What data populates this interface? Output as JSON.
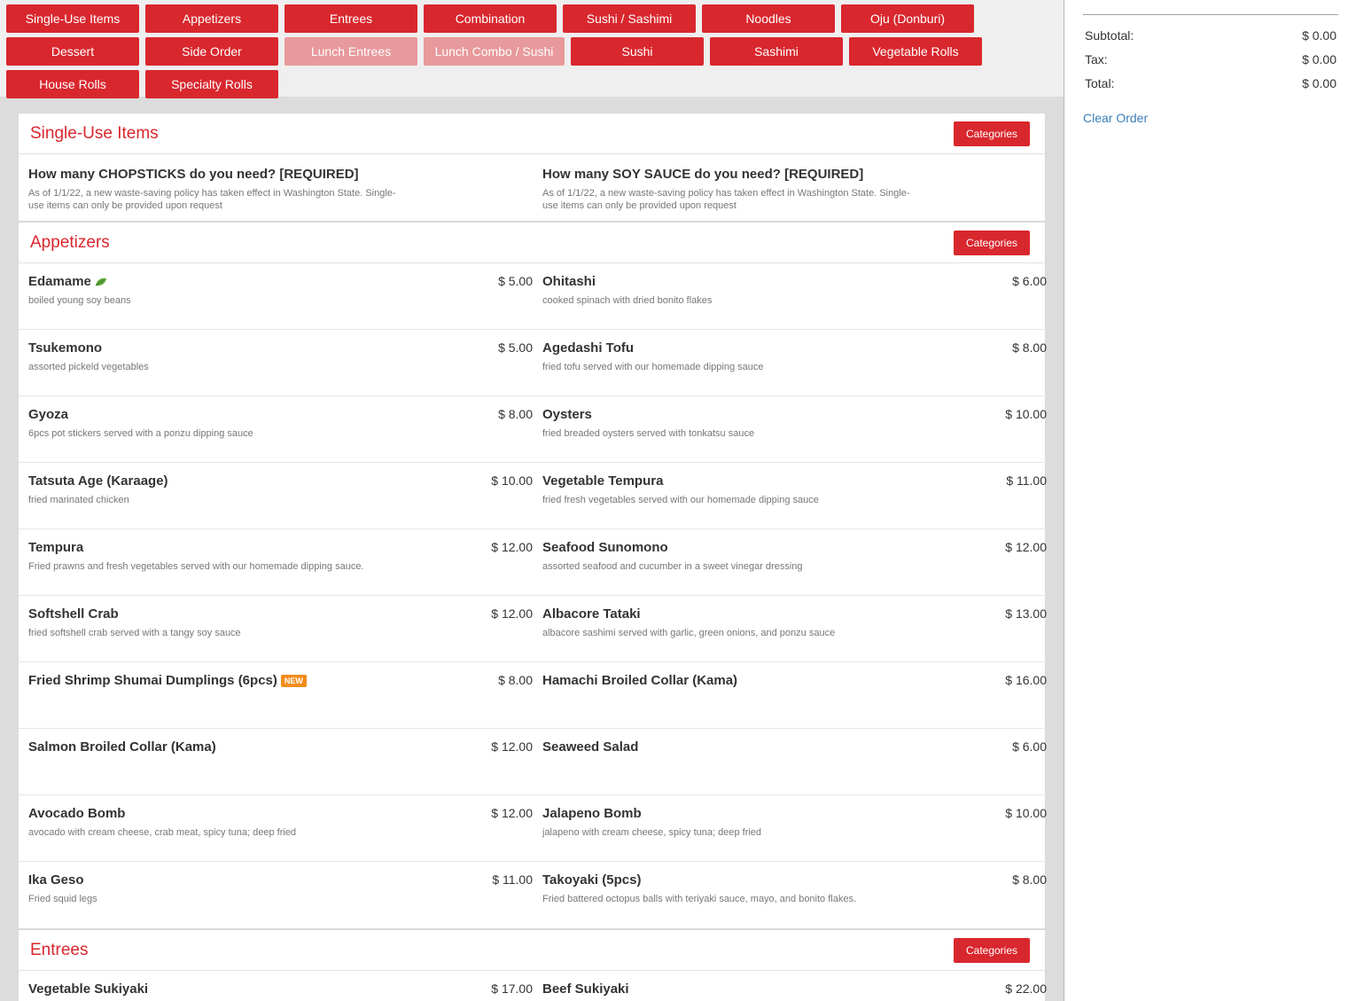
{
  "categories": {
    "row1": [
      {
        "label": "Single-Use Items",
        "disabled": false
      },
      {
        "label": "Appetizers",
        "disabled": false
      },
      {
        "label": "Entrees",
        "disabled": false
      },
      {
        "label": "Combination",
        "disabled": false
      },
      {
        "label": "Sushi / Sashimi",
        "disabled": false
      },
      {
        "label": "Noodles",
        "disabled": false
      },
      {
        "label": "Oju (Donburi)",
        "disabled": false
      }
    ],
    "row2": [
      {
        "label": "Dessert",
        "disabled": false
      },
      {
        "label": "Side Order",
        "disabled": false
      },
      {
        "label": "Lunch Entrees",
        "disabled": true
      },
      {
        "label": "Lunch Combo / Sushi",
        "disabled": true
      },
      {
        "label": "Sushi",
        "disabled": false
      },
      {
        "label": "Sashimi",
        "disabled": false
      },
      {
        "label": "Vegetable Rolls",
        "disabled": false
      }
    ],
    "row3": [
      {
        "label": "House Rolls",
        "disabled": false
      },
      {
        "label": "Specialty Rolls",
        "disabled": false
      }
    ]
  },
  "categories_button_label": "Categories",
  "sections": {
    "single": {
      "title": "Single-Use Items",
      "items": [
        {
          "name": "How many CHOPSTICKS do you need? [REQUIRED]",
          "desc": "As of 1/1/22, a new waste-saving policy has taken effect in Washington State. Single-use items can only be provided upon request"
        },
        {
          "name": "How many SOY SAUCE do you need? [REQUIRED]",
          "desc": "As of 1/1/22, a new waste-saving policy has taken effect in Washington State. Single-use items can only be provided upon request"
        }
      ]
    },
    "appetizers": {
      "title": "Appetizers",
      "items": [
        {
          "name": "Edamame",
          "price": "$ 5.00",
          "desc": "boiled young soy beans",
          "vegetarian": true
        },
        {
          "name": "Ohitashi",
          "price": "$ 6.00",
          "desc": "cooked spinach with dried bonito flakes"
        },
        {
          "name": "Tsukemono",
          "price": "$ 5.00",
          "desc": "assorted pickeld vegetables"
        },
        {
          "name": "Agedashi Tofu",
          "price": "$ 8.00",
          "desc": "fried tofu served with our homemade dipping sauce"
        },
        {
          "name": "Gyoza",
          "price": "$ 8.00",
          "desc": "6pcs pot stickers served with a ponzu dipping sauce"
        },
        {
          "name": "Oysters",
          "price": "$ 10.00",
          "desc": "fried breaded oysters served with tonkatsu sauce"
        },
        {
          "name": "Tatsuta Age (Karaage)",
          "price": "$ 10.00",
          "desc": "fried marinated chicken"
        },
        {
          "name": "Vegetable Tempura",
          "price": "$ 11.00",
          "desc": "fried fresh vegetables served with our homemade dipping sauce"
        },
        {
          "name": "Tempura",
          "price": "$ 12.00",
          "desc": "Fried prawns and fresh vegetables served with our homemade dipping sauce."
        },
        {
          "name": "Seafood Sunomono",
          "price": "$ 12.00",
          "desc": "assorted seafood and cucumber in a sweet vinegar dressing"
        },
        {
          "name": "Softshell Crab",
          "price": "$ 12.00",
          "desc": "fried softshell crab served with a tangy soy sauce"
        },
        {
          "name": "Albacore Tataki",
          "price": "$ 13.00",
          "desc": "albacore sashimi served with garlic, green onions, and ponzu sauce"
        },
        {
          "name": "Fried Shrimp Shumai Dumplings (6pcs)",
          "price": "$ 8.00",
          "desc": "",
          "badge": "NEW"
        },
        {
          "name": "Hamachi Broiled Collar (Kama)",
          "price": "$ 16.00",
          "desc": ""
        },
        {
          "name": "Salmon Broiled Collar (Kama)",
          "price": "$ 12.00",
          "desc": ""
        },
        {
          "name": "Seaweed Salad",
          "price": "$ 6.00",
          "desc": ""
        },
        {
          "name": "Avocado Bomb",
          "price": "$ 12.00",
          "desc": "avocado with cream cheese, crab meat, spicy tuna; deep fried"
        },
        {
          "name": "Jalapeno Bomb",
          "price": "$ 10.00",
          "desc": "jalapeno with cream cheese, spicy tuna; deep fried"
        },
        {
          "name": "Ika Geso",
          "price": "$ 11.00",
          "desc": "Fried squid legs"
        },
        {
          "name": "Takoyaki (5pcs)",
          "price": "$ 8.00",
          "desc": "Fried battered octopus balls with teriyaki sauce, mayo, and bonito flakes."
        }
      ]
    },
    "entrees": {
      "title": "Entrees",
      "items": [
        {
          "name": "Vegetable Sukiyaki",
          "price": "$ 17.00",
          "desc": ""
        },
        {
          "name": "Beef Sukiyaki",
          "price": "$ 22.00",
          "desc": ""
        }
      ]
    }
  },
  "cart": {
    "subtotal_label": "Subtotal:",
    "subtotal": "$ 0.00",
    "tax_label": "Tax:",
    "tax": "$ 0.00",
    "total_label": "Total:",
    "total": "$ 0.00",
    "clear_label": "Clear Order"
  },
  "colors": {
    "accent": "#d9272e",
    "disabled": "#e8999b",
    "link": "#3a7fb8",
    "badge": "#f28c1c"
  },
  "icons": {
    "vegetarian": "leaf-icon"
  }
}
